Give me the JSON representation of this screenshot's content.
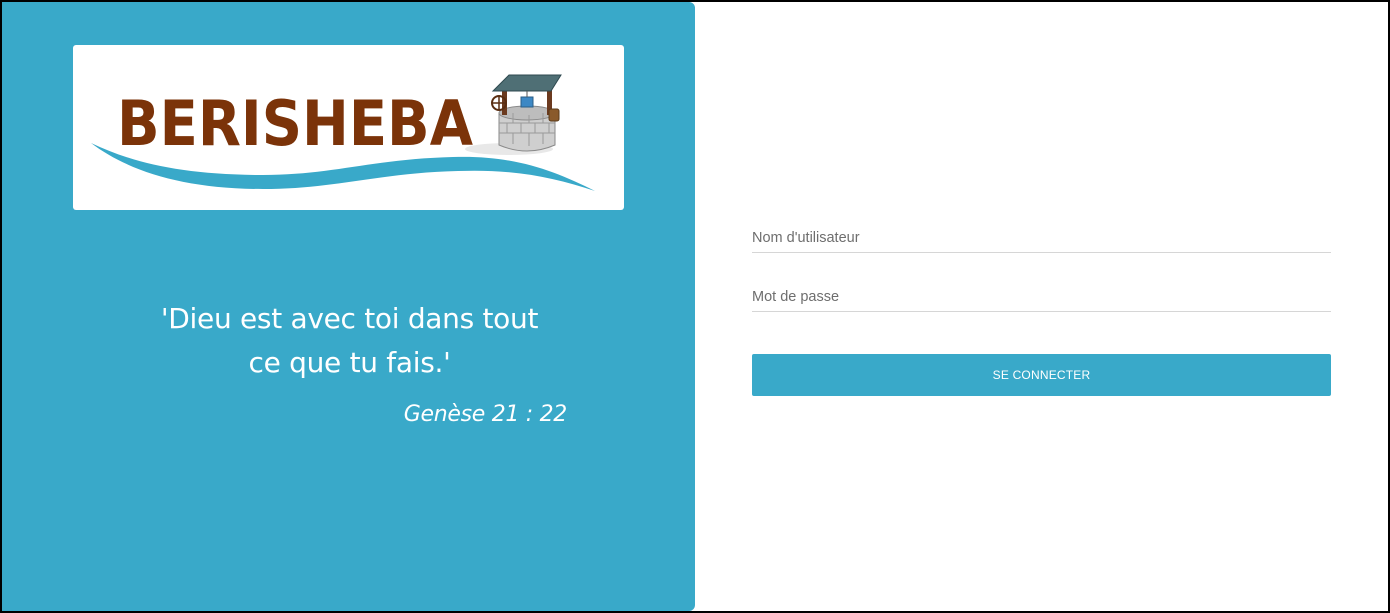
{
  "brand": {
    "logo_text": "BERISHEBA",
    "logo_text_color": "#7b3309",
    "wave_color": "#39a9c9",
    "logo_icon": "well-icon"
  },
  "quote": {
    "line1": "'Dieu est avec toi dans tout",
    "line2": "ce que tu fais.'",
    "reference": "Genèse 21 : 22"
  },
  "login_form": {
    "username_placeholder": "Nom d'utilisateur",
    "password_placeholder": "Mot de passe",
    "submit_label": "SE CONNECTER"
  },
  "colors": {
    "accent": "#39a9c9",
    "background": "#ffffff"
  }
}
